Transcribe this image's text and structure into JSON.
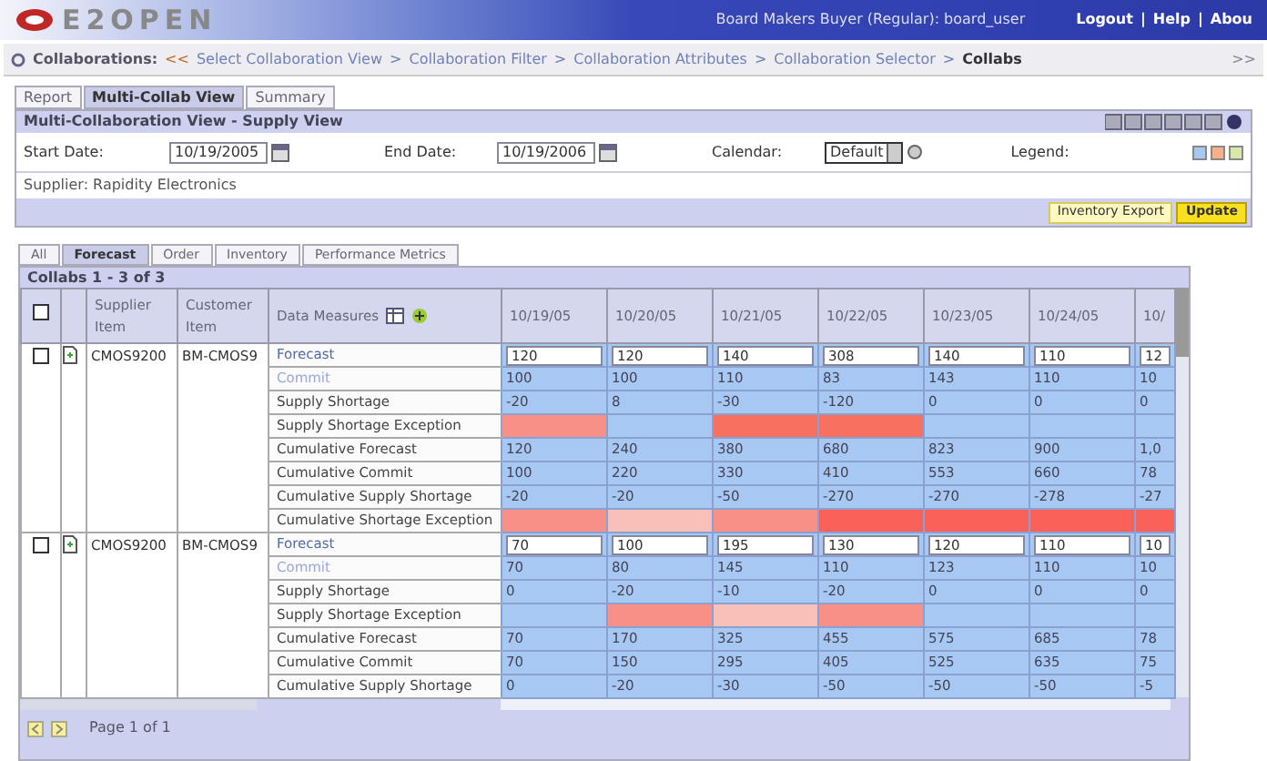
{
  "header": {
    "logo": "E2OPEN",
    "user": "Board Makers Buyer (Regular): board_user",
    "links": [
      "Logout",
      "|",
      "Help",
      "|",
      "Abou"
    ]
  },
  "breadcrumb": {
    "title": "Collaborations:",
    "items": [
      {
        "label": "<<",
        "kind": "nav"
      },
      {
        "label": "Select Collaboration View",
        "kind": "link"
      },
      {
        "label": ">",
        "kind": "sep"
      },
      {
        "label": "Collaboration Filter",
        "kind": "link"
      },
      {
        "label": ">",
        "kind": "sep"
      },
      {
        "label": "Collaboration Attributes",
        "kind": "link"
      },
      {
        "label": ">",
        "kind": "sep"
      },
      {
        "label": "Collaboration Selector",
        "kind": "link"
      },
      {
        "label": ">",
        "kind": "sep"
      },
      {
        "label": "Collabs",
        "kind": "current"
      }
    ],
    "more": ">>"
  },
  "tabs": [
    {
      "label": "Report",
      "selected": false
    },
    {
      "label": "Multi-Collab View",
      "selected": true
    },
    {
      "label": "Summary",
      "selected": false
    }
  ],
  "panel": {
    "title": "Multi-Collaboration View - Supply View",
    "start_label": "Start Date:",
    "start_value": "10/19/2005",
    "end_label": "End Date:",
    "end_value": "10/19/2006",
    "calendar_label": "Calendar:",
    "calendar_value": "Default",
    "legend_label": "Legend:",
    "legend": [
      {
        "color": "#a8c8f0"
      },
      {
        "color": "#f8b088"
      },
      {
        "color": "#d8e8a8"
      }
    ],
    "supplier": "Supplier: Rapidity Electronics",
    "buttons": [
      {
        "label": "Inventory Export",
        "kind": "normal"
      },
      {
        "label": "Update",
        "kind": "primary"
      }
    ]
  },
  "subtabs": [
    {
      "label": "All",
      "selected": false
    },
    {
      "label": "Forecast",
      "selected": true
    },
    {
      "label": "Order",
      "selected": false
    },
    {
      "label": "Inventory",
      "selected": false
    },
    {
      "label": "Performance Metrics",
      "selected": false
    }
  ],
  "count": "Collabs 1 - 3 of 3",
  "columns": {
    "select_all_checked": false,
    "supplier": "Supplier Item",
    "customer": "Customer Item",
    "measures": "Data Measures",
    "dates": [
      "10/19/05",
      "10/20/05",
      "10/21/05",
      "10/22/05",
      "10/23/05",
      "10/24/05",
      "10/"
    ]
  },
  "groups": [
    {
      "checked": false,
      "supplier_item": "CMOS9200",
      "customer_item": "BM-CMOS9",
      "rows": [
        {
          "measure": "Forecast",
          "kind": "input",
          "cells": [
            "120",
            "120",
            "140",
            "308",
            "140",
            "110",
            "12"
          ]
        },
        {
          "measure": "Commit",
          "kind": "commit",
          "cells": [
            "100",
            "100",
            "110",
            "83",
            "143",
            "110",
            "10"
          ]
        },
        {
          "measure": "Supply Shortage",
          "kind": "value",
          "cells": [
            "-20",
            "8",
            "-30",
            "-120",
            "0",
            "0",
            "0"
          ]
        },
        {
          "measure": "Supply Shortage Exception",
          "kind": "exception",
          "cells": [
            {
              "color": "#f89088"
            },
            {
              "color": "#a8c8f4"
            },
            {
              "color": "#f87060"
            },
            {
              "color": "#f87060"
            },
            {
              "color": "#a8c8f4"
            },
            {
              "color": "#a8c8f4"
            },
            {
              "color": "#a8c8f4"
            }
          ]
        },
        {
          "measure": "Cumulative Forecast",
          "kind": "value",
          "cells": [
            "120",
            "240",
            "380",
            "680",
            "823",
            "900",
            "1,0"
          ]
        },
        {
          "measure": "Cumulative Commit",
          "kind": "value",
          "cells": [
            "100",
            "220",
            "330",
            "410",
            "553",
            "660",
            "78"
          ]
        },
        {
          "measure": "Cumulative Supply Shortage",
          "kind": "value",
          "cells": [
            "-20",
            "-20",
            "-50",
            "-270",
            "-270",
            "-278",
            "-27"
          ]
        },
        {
          "measure": "Cumulative Shortage Exception",
          "kind": "exception",
          "cells": [
            {
              "color": "#f89088"
            },
            {
              "color": "#f8c0b8"
            },
            {
              "color": "#f89088"
            },
            {
              "color": "#f86058"
            },
            {
              "color": "#f86058"
            },
            {
              "color": "#f86058"
            },
            {
              "color": "#f86058"
            }
          ]
        }
      ]
    },
    {
      "checked": false,
      "supplier_item": "CMOS9200",
      "customer_item": "BM-CMOS9",
      "rows": [
        {
          "measure": "Forecast",
          "kind": "input",
          "cells": [
            "70",
            "100",
            "195",
            "130",
            "120",
            "110",
            "10"
          ]
        },
        {
          "measure": "Commit",
          "kind": "commit",
          "cells": [
            "70",
            "80",
            "145",
            "110",
            "123",
            "110",
            "10"
          ]
        },
        {
          "measure": "Supply Shortage",
          "kind": "value",
          "cells": [
            "0",
            "-20",
            "-10",
            "-20",
            "0",
            "0",
            "0"
          ]
        },
        {
          "measure": "Supply Shortage Exception",
          "kind": "exception",
          "cells": [
            {
              "color": "#a8c8f4"
            },
            {
              "color": "#f89088"
            },
            {
              "color": "#f8c0b8"
            },
            {
              "color": "#f89088"
            },
            {
              "color": "#a8c8f4"
            },
            {
              "color": "#a8c8f4"
            },
            {
              "color": "#a8c8f4"
            }
          ]
        },
        {
          "measure": "Cumulative Forecast",
          "kind": "value",
          "cells": [
            "70",
            "170",
            "325",
            "455",
            "575",
            "685",
            "78"
          ]
        },
        {
          "measure": "Cumulative Commit",
          "kind": "value",
          "cells": [
            "70",
            "150",
            "295",
            "405",
            "525",
            "635",
            "75"
          ]
        },
        {
          "measure": "Cumulative Supply Shortage",
          "kind": "value",
          "cells": [
            "0",
            "-20",
            "-30",
            "-50",
            "-50",
            "-50",
            "-5"
          ]
        }
      ]
    }
  ],
  "footer": {
    "page": "Page 1 of 1"
  }
}
